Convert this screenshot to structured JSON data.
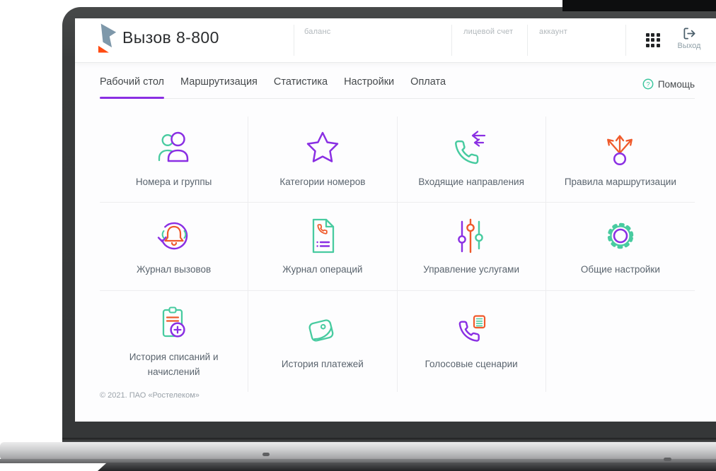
{
  "header": {
    "app_title": "Вызов 8-800",
    "balance_label": "баланс",
    "account_number_label": "лицевой счет",
    "account_label": "аккаунт",
    "exit_label": "Выход"
  },
  "nav": {
    "tabs": [
      {
        "label": "Рабочий стол"
      },
      {
        "label": "Маршрутизация"
      },
      {
        "label": "Статистика"
      },
      {
        "label": "Настройки"
      },
      {
        "label": "Оплата"
      }
    ],
    "active_tab": "Рабочий стол",
    "help_label": "Помощь"
  },
  "tiles": [
    {
      "label": "Номера и группы",
      "icon": "users-icon"
    },
    {
      "label": "Категории номеров",
      "icon": "star-icon"
    },
    {
      "label": "Входящие направления",
      "icon": "incoming-call-icon"
    },
    {
      "label": "Правила маршрутизации",
      "icon": "routing-icon"
    },
    {
      "label": "Журнал вызовов",
      "icon": "call-log-icon"
    },
    {
      "label": "Журнал операций",
      "icon": "operations-log-icon"
    },
    {
      "label": "Управление услугами",
      "icon": "sliders-icon"
    },
    {
      "label": "Общие настройки",
      "icon": "gear-icon"
    },
    {
      "label": "История списаний и начислений",
      "icon": "billing-history-icon"
    },
    {
      "label": "История платежей",
      "icon": "payments-icon"
    },
    {
      "label": "Голосовые сценарии",
      "icon": "voice-scripts-icon"
    }
  ],
  "footer": {
    "copyright": "© 2021. ПАО «Ростелеком»"
  },
  "colors": {
    "purple": "#8a2fe3",
    "green": "#48cba0",
    "orange": "#ef5a2b",
    "logo_slate": "#7e98aa",
    "logo_orange": "#ff4b12",
    "exit_icon": "#4b5f6b"
  }
}
